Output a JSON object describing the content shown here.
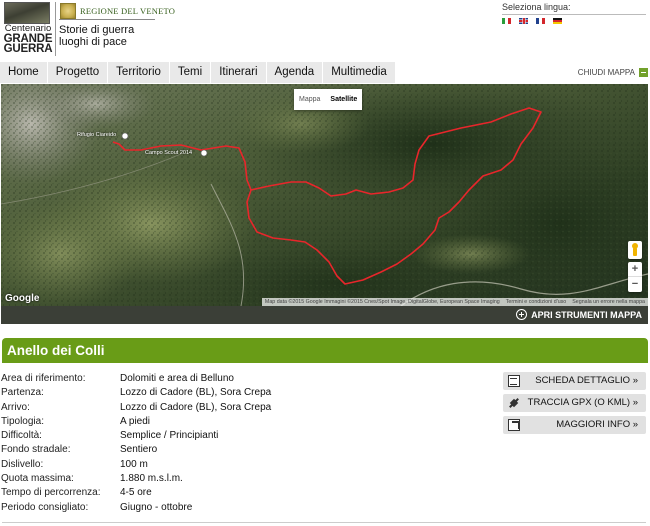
{
  "header": {
    "logo": {
      "line1": "Centenario",
      "line2": "GRANDE",
      "line3": "GUERRA"
    },
    "regione": "REGIONE DEL VENETO",
    "tagline_line1": "Storie di guerra",
    "tagline_line2": "luoghi di pace",
    "language": {
      "label": "Seleziona lingua:",
      "flags": [
        "flag-it-icon",
        "flag-en-icon",
        "flag-fr-icon",
        "flag-de-icon"
      ]
    }
  },
  "nav": {
    "items": [
      "Home",
      "Progetto",
      "Territorio",
      "Temi",
      "Itinerari",
      "Agenda",
      "Multimedia"
    ],
    "close_map": "CHIUDI MAPPA"
  },
  "map": {
    "type_buttons": {
      "map": "Mappa",
      "satellite": "Satellite",
      "selected": "Satellite"
    },
    "places": {
      "rifugio": "Rifugio Ciareido",
      "campo": "Campo Scout 2014"
    },
    "zoom_in": "+",
    "zoom_out": "−",
    "google": "Google",
    "attribution": {
      "data": "Map data ©2015 Google Immagini ©2015 Cnes/Spot Image, DigitalGlobe, European Space Imaging",
      "terms": "Termini e condizioni d'uso",
      "report": "Segnala un errore nella mappa"
    },
    "route_color": "#e8262b"
  },
  "tools_bar": {
    "open_tools": "APRI STRUMENTI MAPPA"
  },
  "itinerary": {
    "title": "Anello dei Colli",
    "accent": "#699c17",
    "details": [
      {
        "label": "Area di riferimento:",
        "value": "Dolomiti e area di Belluno"
      },
      {
        "label": "Partenza:",
        "value": "Lozzo di Cadore (BL), Sora Crepa"
      },
      {
        "label": "Arrivo:",
        "value": "Lozzo di Cadore (BL), Sora Crepa"
      },
      {
        "label": "Tipologia:",
        "value": "A piedi"
      },
      {
        "label": "Difficoltà:",
        "value": "Semplice / Principianti"
      },
      {
        "label": "Fondo stradale:",
        "value": "Sentiero"
      },
      {
        "label": "Dislivello:",
        "value": "100 m"
      },
      {
        "label": "Quota massima:",
        "value": "1.880 m.s.l.m."
      },
      {
        "label": "Tempo di percorrenza:",
        "value": "4-5 ore"
      },
      {
        "label": "Periodo consigliato:",
        "value": "Giugno - ottobre"
      }
    ],
    "actions": {
      "scheda": "SCHEDA DETTAGLIO »",
      "gpx": "TRACCIA GPX (O KML) »",
      "info": "MAGGIORI INFO »"
    }
  }
}
